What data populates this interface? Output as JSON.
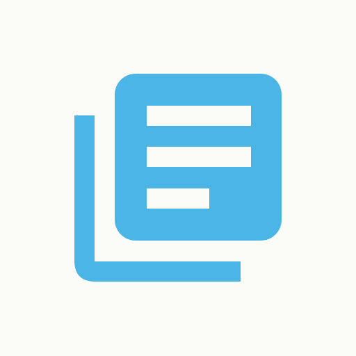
{
  "icon": {
    "name": "library-books-icon",
    "color": "#4bb5e6",
    "background": "#fbfcf7"
  }
}
